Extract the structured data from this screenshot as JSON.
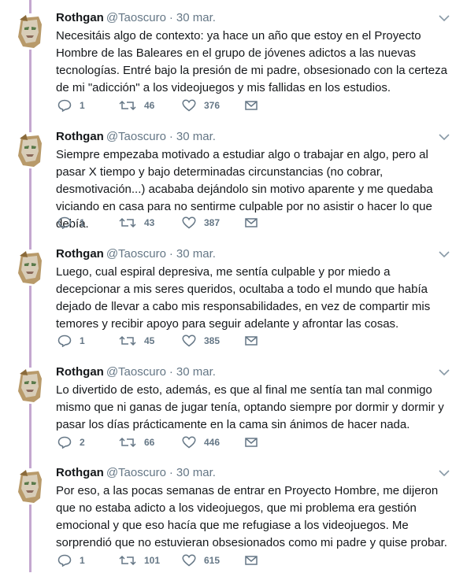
{
  "tweets": [
    {
      "name": "Rothgan",
      "handle": "@Taoscuro",
      "separator": "·",
      "date": "30 mar.",
      "text": "Necesitáis algo de contexto: ya hace un año que estoy en el Proyecto Hombre de las Baleares en el grupo de jóvenes adictos a las nuevas tecnologías. Entré bajo la presión de mi padre, obsesionado con la certeza de mi \"adicción\" a los videojuegos y mis fallidas en los estudios.",
      "replies": "1",
      "retweets": "46",
      "likes": "376"
    },
    {
      "name": "Rothgan",
      "handle": "@Taoscuro",
      "separator": "·",
      "date": "30 mar.",
      "text": "Siempre empezaba motivado a estudiar algo o trabajar en algo, pero al pasar X tiempo y bajo determinadas circunstancias (no cobrar, desmotivación...) acababa dejándolo sin motivo aparente y me quedaba viciando en casa para no sentirme culpable por no asistir o hacer lo que debía.",
      "replies": "1",
      "retweets": "43",
      "likes": "387"
    },
    {
      "name": "Rothgan",
      "handle": "@Taoscuro",
      "separator": "·",
      "date": "30 mar.",
      "text": "Luego, cual espiral depresiva, me sentía culpable y por miedo a decepcionar a mis seres queridos, ocultaba a todo el mundo que había dejado de llevar a cabo mis responsabilidades, en vez de compartir mis temores y recibir apoyo para seguir adelante y afrontar las cosas.",
      "replies": "1",
      "retweets": "45",
      "likes": "385"
    },
    {
      "name": "Rothgan",
      "handle": "@Taoscuro",
      "separator": "·",
      "date": "30 mar.",
      "text": "Lo divertido de esto, además, es que al final me sentía tan mal conmigo mismo que ni ganas de jugar tenía, optando siempre por dormir y dormir y pasar los días prácticamente en la cama sin ánimos de hacer nada.",
      "replies": "2",
      "retweets": "66",
      "likes": "446"
    },
    {
      "name": "Rothgan",
      "handle": "@Taoscuro",
      "separator": "·",
      "date": "30 mar.",
      "text": "Por eso, a las pocas semanas de entrar en Proyecto Hombre, me dijeron que no estaba adicto a los videojuegos, que mi problema era gestión emocional y que eso hacía que me refugiase a los videojuegos. Me sorprendió que no estuvieran obsesionados como mi padre y quise probar.",
      "replies": "1",
      "retweets": "101",
      "likes": "615"
    }
  ],
  "colors": {
    "thread_line": "#c4a8d0",
    "meta_gray": "#657786",
    "text": "#14171a"
  },
  "icons": {
    "reply": "reply-icon",
    "retweet": "retweet-icon",
    "like": "heart-icon",
    "message": "envelope-icon",
    "caret": "chevron-down-icon"
  }
}
